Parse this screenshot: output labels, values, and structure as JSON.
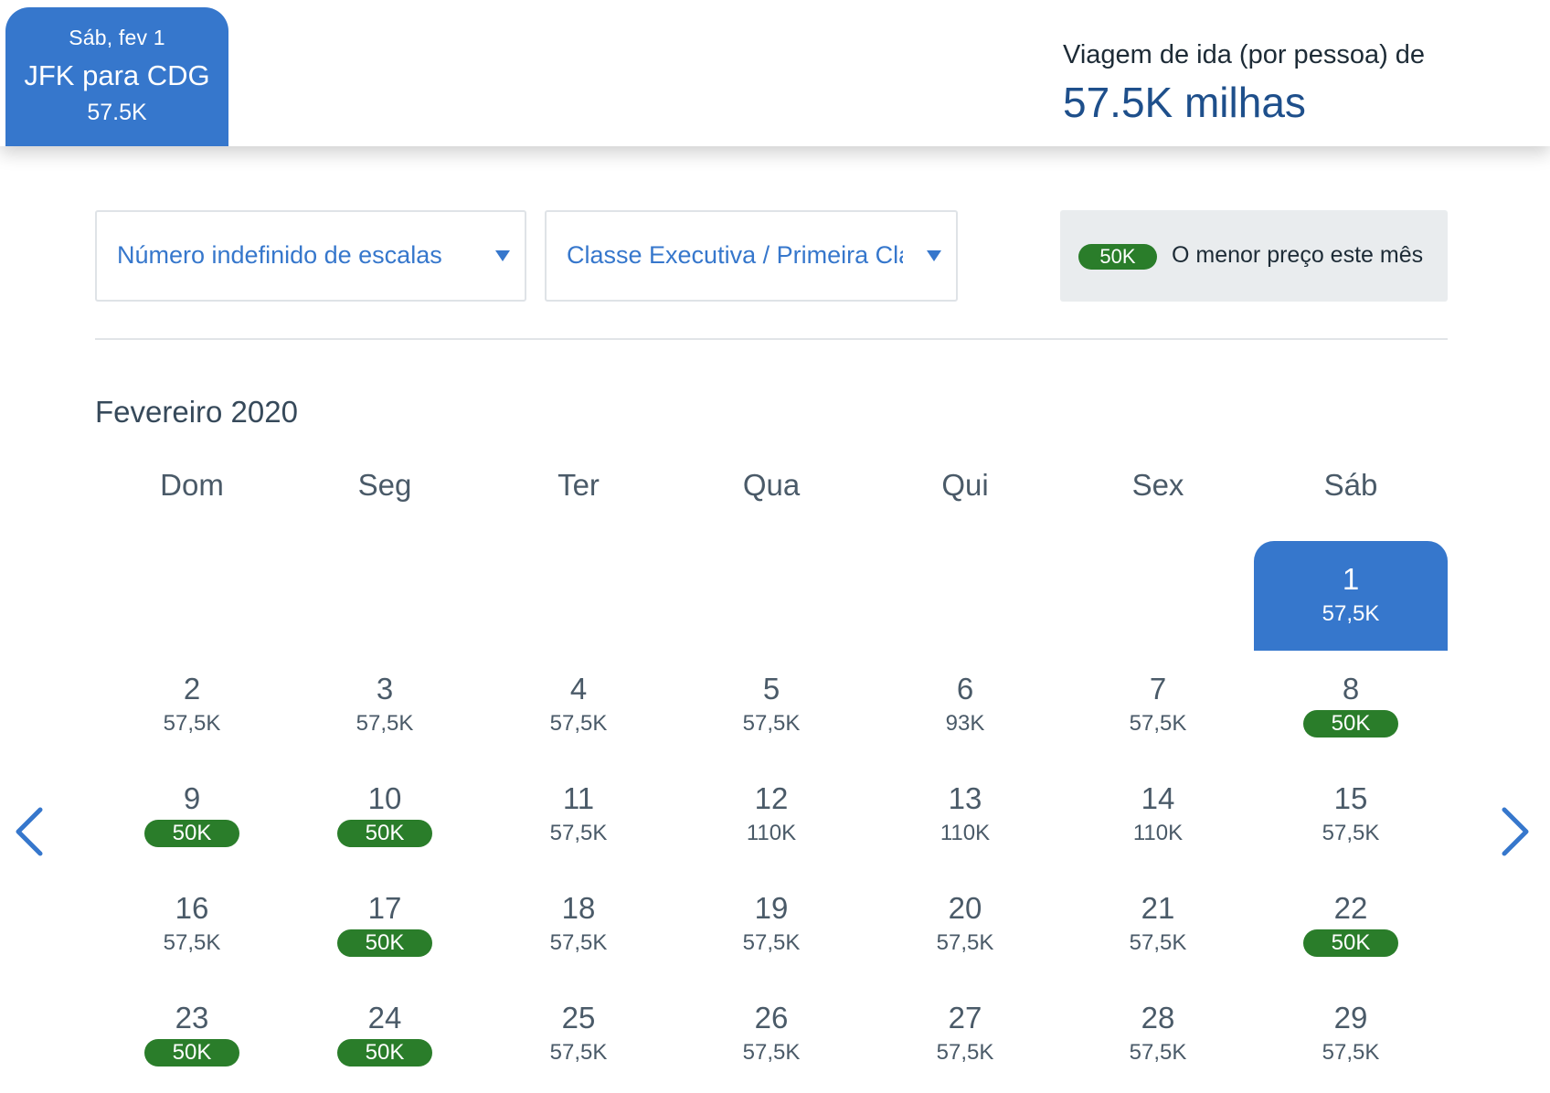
{
  "header": {
    "trip_tab": {
      "date": "Sáb, fev 1",
      "route": "JFK para CDG",
      "price": "57.5K"
    },
    "fare_label": "Viagem de ida (por pessoa) de",
    "fare_amount": "57.5K milhas"
  },
  "filters": {
    "stops": "Número indefinido de escalas",
    "cabin": "Classe Executiva / Primeira Classe"
  },
  "legend": {
    "badge": "50K",
    "text": "O menor preço este mês"
  },
  "calendar": {
    "month": "Fevereiro 2020",
    "weekdays": [
      "Dom",
      "Seg",
      "Ter",
      "Qua",
      "Qui",
      "Sex",
      "Sáb"
    ],
    "days": [
      {
        "day": "1",
        "price": "57,5K",
        "lowest": false,
        "selected": true
      },
      {
        "day": "2",
        "price": "57,5K",
        "lowest": false
      },
      {
        "day": "3",
        "price": "57,5K",
        "lowest": false
      },
      {
        "day": "4",
        "price": "57,5K",
        "lowest": false
      },
      {
        "day": "5",
        "price": "57,5K",
        "lowest": false
      },
      {
        "day": "6",
        "price": "93K",
        "lowest": false
      },
      {
        "day": "7",
        "price": "57,5K",
        "lowest": false
      },
      {
        "day": "8",
        "price": "50K",
        "lowest": true
      },
      {
        "day": "9",
        "price": "50K",
        "lowest": true
      },
      {
        "day": "10",
        "price": "50K",
        "lowest": true
      },
      {
        "day": "11",
        "price": "57,5K",
        "lowest": false
      },
      {
        "day": "12",
        "price": "110K",
        "lowest": false
      },
      {
        "day": "13",
        "price": "110K",
        "lowest": false
      },
      {
        "day": "14",
        "price": "110K",
        "lowest": false
      },
      {
        "day": "15",
        "price": "57,5K",
        "lowest": false
      },
      {
        "day": "16",
        "price": "57,5K",
        "lowest": false
      },
      {
        "day": "17",
        "price": "50K",
        "lowest": true
      },
      {
        "day": "18",
        "price": "57,5K",
        "lowest": false
      },
      {
        "day": "19",
        "price": "57,5K",
        "lowest": false
      },
      {
        "day": "20",
        "price": "57,5K",
        "lowest": false
      },
      {
        "day": "21",
        "price": "57,5K",
        "lowest": false
      },
      {
        "day": "22",
        "price": "50K",
        "lowest": true
      },
      {
        "day": "23",
        "price": "50K",
        "lowest": true
      },
      {
        "day": "24",
        "price": "50K",
        "lowest": true
      },
      {
        "day": "25",
        "price": "57,5K",
        "lowest": false
      },
      {
        "day": "26",
        "price": "57,5K",
        "lowest": false
      },
      {
        "day": "27",
        "price": "57,5K",
        "lowest": false
      },
      {
        "day": "28",
        "price": "57,5K",
        "lowest": false
      },
      {
        "day": "29",
        "price": "57,5K",
        "lowest": false
      }
    ]
  },
  "colors": {
    "primary_blue": "#3677cc",
    "lowest_green": "#2a7d2a",
    "fare_blue": "#1e4f8b"
  },
  "icons": {
    "prev": "chevron-left-icon",
    "next": "chevron-right-icon",
    "dropdown": "caret-down-icon"
  }
}
